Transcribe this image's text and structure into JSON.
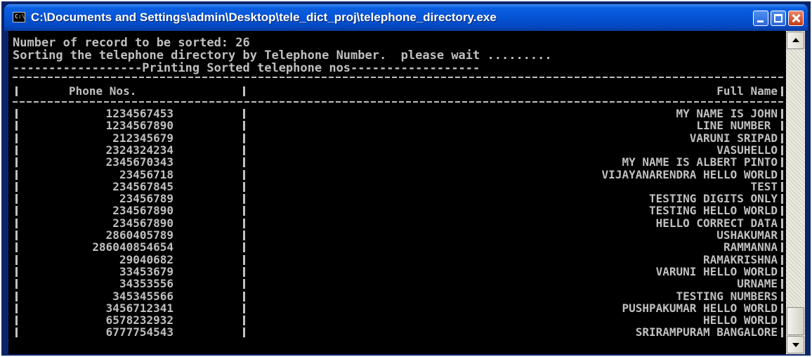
{
  "window": {
    "title": "C:\\Documents and Settings\\admin\\Desktop\\tele_dict_proj\\telephone_directory.exe",
    "icon": "console-app-icon",
    "icon_glyph": "C:\\"
  },
  "console": {
    "lines": [
      "Number of record to be sorted: 26",
      "Sorting the telephone directory by Telephone Number.  please wait .........",
      "------------------Printing Sorted telephone nos------------------"
    ],
    "header": {
      "phone": "Phone Nos.",
      "name": "Full Name"
    },
    "rows": [
      {
        "phone": "1234567453",
        "name": "MY NAME IS JOHN"
      },
      {
        "phone": "1234567890",
        "name": "LINE NUMBER "
      },
      {
        "phone": "212345679",
        "name": "VARUNI SRIPAD"
      },
      {
        "phone": "2324324234",
        "name": "VASUHELLO"
      },
      {
        "phone": "2345670343",
        "name": "MY NAME IS ALBERT PINTO"
      },
      {
        "phone": "23456718",
        "name": "VIJAYANARENDRA HELLO WORLD"
      },
      {
        "phone": "234567845",
        "name": "TEST"
      },
      {
        "phone": "23456789",
        "name": "TESTING DIGITS ONLY"
      },
      {
        "phone": "234567890",
        "name": "TESTING HELLO WORLD"
      },
      {
        "phone": "234567890",
        "name": "HELLO CORRECT DATA"
      },
      {
        "phone": "2860405789",
        "name": "USHAKUMAR"
      },
      {
        "phone": "286040854654",
        "name": "RAMMANNA"
      },
      {
        "phone": "29040682",
        "name": "RAMAKRISHNA"
      },
      {
        "phone": "33453679",
        "name": "VARUNI HELLO WORLD"
      },
      {
        "phone": "34353556",
        "name": "URNAME"
      },
      {
        "phone": "345345566",
        "name": "TESTING NUMBERS"
      },
      {
        "phone": "3456712341",
        "name": "PUSHPAKUMAR HELLO WORLD"
      },
      {
        "phone": "6578232932",
        "name": "HELLO WORLD"
      },
      {
        "phone": "6777754543",
        "name": "SRIRAMPURAM BANGALORE"
      }
    ]
  },
  "scrollbar": {
    "position": 0.92
  }
}
